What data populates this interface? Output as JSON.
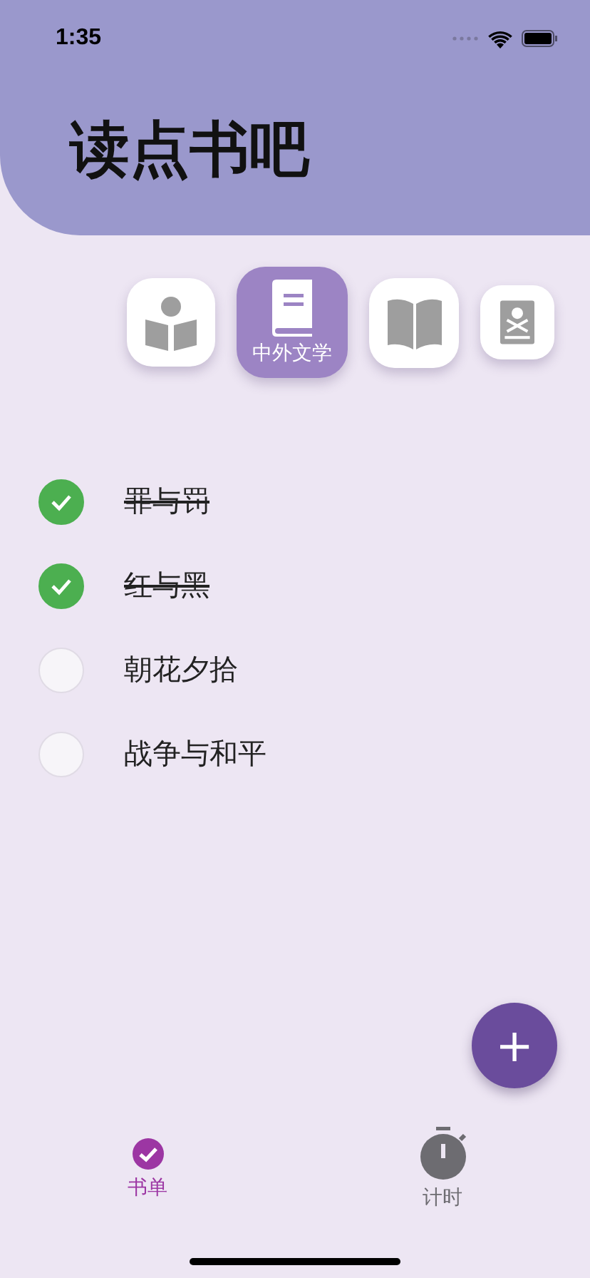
{
  "status_bar": {
    "time": "1:35"
  },
  "header": {
    "title": "读点书吧"
  },
  "categories": [
    {
      "kind": "reader",
      "selected": false
    },
    {
      "kind": "book",
      "selected": true,
      "label": "中外文学"
    },
    {
      "kind": "open-book",
      "selected": false
    },
    {
      "kind": "skull-book",
      "selected": false
    }
  ],
  "books": [
    {
      "title": "罪与罚",
      "checked": true
    },
    {
      "title": "红与黑",
      "checked": true
    },
    {
      "title": "朝花夕拾",
      "checked": false
    },
    {
      "title": "战争与和平",
      "checked": false
    }
  ],
  "fab": {
    "label": "+"
  },
  "tabs": [
    {
      "kind": "list",
      "label": "书单",
      "selected": true
    },
    {
      "kind": "timer",
      "label": "计时",
      "selected": false
    }
  ]
}
